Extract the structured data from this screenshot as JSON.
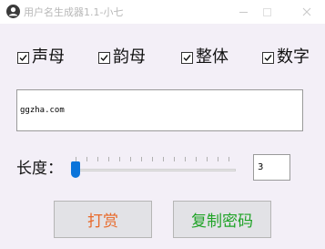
{
  "window": {
    "title": "用户名生成器1.1-小七"
  },
  "options": [
    {
      "label": "声母",
      "checked": true
    },
    {
      "label": "韵母",
      "checked": true
    },
    {
      "label": "整体",
      "checked": true
    },
    {
      "label": "数字",
      "checked": true
    }
  ],
  "output": {
    "value": "ggzha.com"
  },
  "length": {
    "label": "长度：",
    "value": "3"
  },
  "buttons": {
    "reward": "打赏",
    "copy": "复制密码"
  },
  "colors": {
    "reward_text": "#e86a2b",
    "copy_text": "#1fa326",
    "slider_thumb": "#0a74da"
  }
}
